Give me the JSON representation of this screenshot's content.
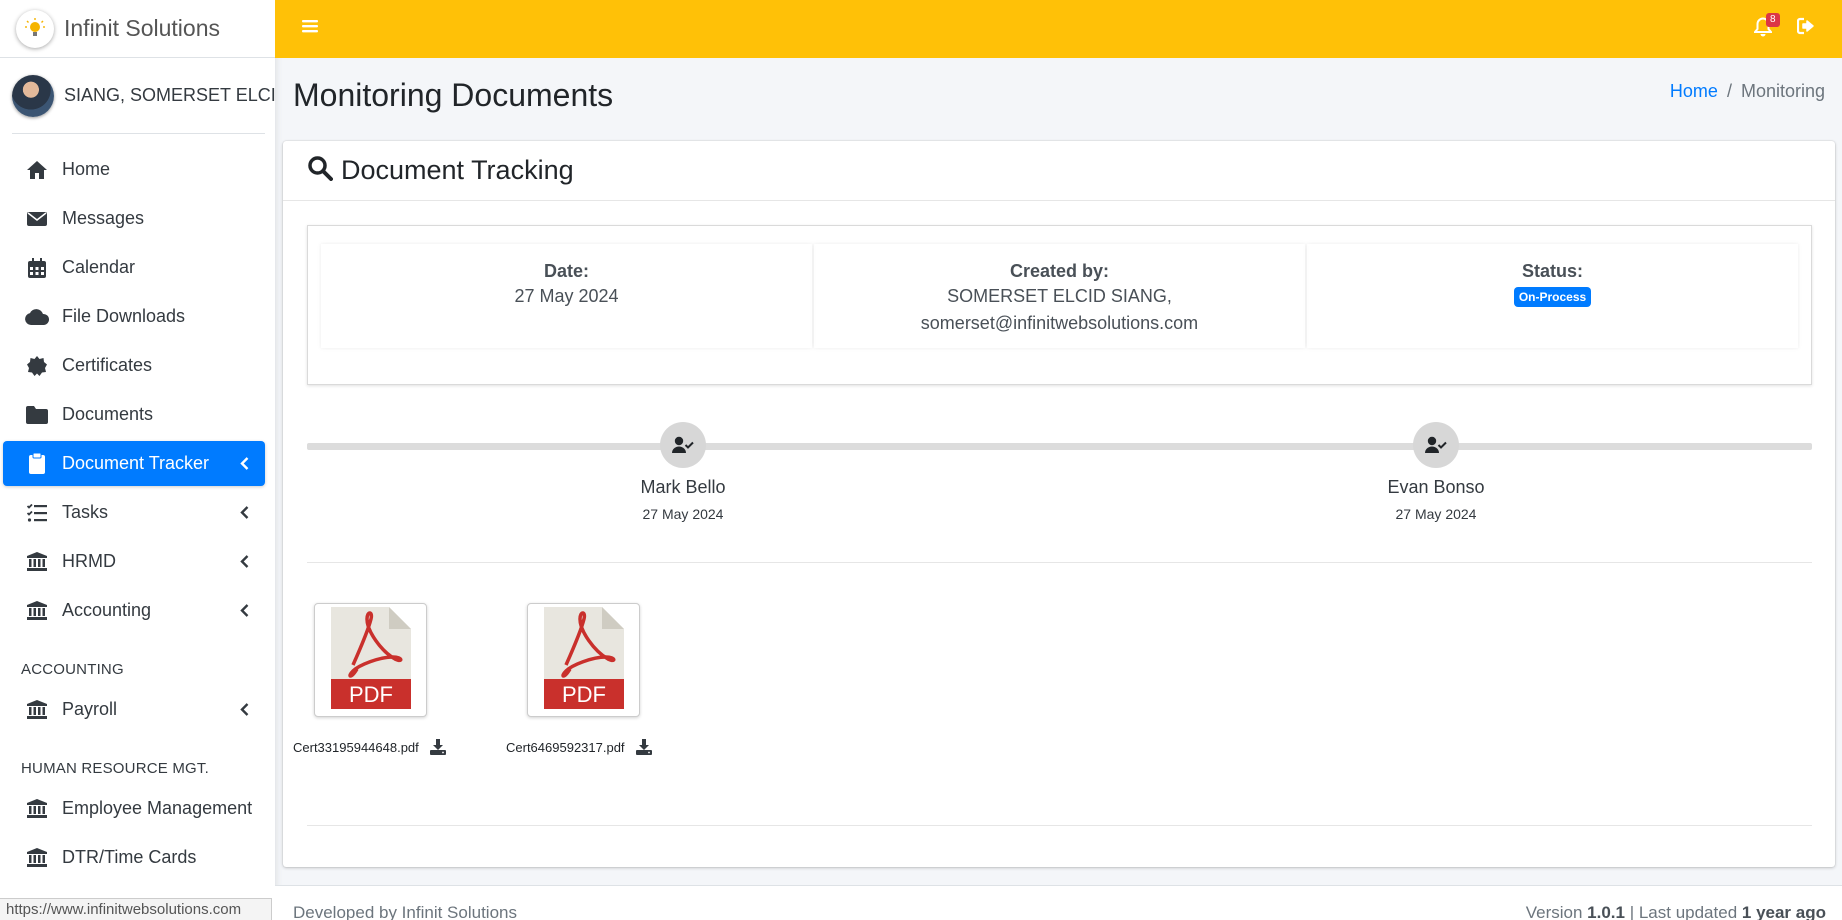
{
  "brand": {
    "name": "Infinit Solutions"
  },
  "user": {
    "name": "SIANG, SOMERSET ELCID"
  },
  "sidebar": {
    "items": [
      {
        "label": "Home",
        "icon": "home-icon"
      },
      {
        "label": "Messages",
        "icon": "envelope-icon"
      },
      {
        "label": "Calendar",
        "icon": "calendar-icon"
      },
      {
        "label": "File Downloads",
        "icon": "cloud-icon"
      },
      {
        "label": "Certificates",
        "icon": "certificate-icon"
      },
      {
        "label": "Documents",
        "icon": "folder-icon"
      },
      {
        "label": "Document Tracker",
        "icon": "clipboard-icon",
        "active": true
      },
      {
        "label": "Tasks",
        "icon": "tasks-icon"
      },
      {
        "label": "HRMD",
        "icon": "bank-icon"
      },
      {
        "label": "Accounting",
        "icon": "bank-icon"
      }
    ],
    "section_accounting": "ACCOUNTING",
    "payroll": {
      "label": "Payroll",
      "icon": "bank-icon"
    },
    "section_hr": "HUMAN RESOURCE MGT.",
    "employee_management": {
      "label": "Employee Management",
      "icon": "bank-icon"
    },
    "dtr": {
      "label": "DTR/Time Cards",
      "icon": "bank-icon"
    }
  },
  "topbar": {
    "notification_count": "8",
    "accent_color": "#ffc107"
  },
  "page": {
    "title": "Monitoring Documents",
    "breadcrumb": {
      "home": "Home",
      "separator": "/",
      "current": "Monitoring"
    }
  },
  "card": {
    "title": "Document Tracking",
    "info": {
      "date_label": "Date:",
      "date_value": "27 May 2024",
      "created_label": "Created by:",
      "created_name": "SOMERSET ELCID SIANG,",
      "created_email": "somerset@infinitwebsolutions.com",
      "status_label": "Status:",
      "status_value": "On-Process"
    },
    "timeline": [
      {
        "name": "Mark Bello",
        "date": "27 May 2024"
      },
      {
        "name": "Evan Bonso",
        "date": "27 May 2024"
      }
    ],
    "files": [
      {
        "name": "Cert33195944648.pdf",
        "type_label": "PDF"
      },
      {
        "name": "Cert6469592317.pdf",
        "type_label": "PDF"
      }
    ]
  },
  "footer": {
    "developed_by": "Developed by Infinit Solutions",
    "version_label": "Version",
    "version": "1.0.1",
    "updated_label": "| Last updated",
    "updated": "1 year ago"
  },
  "status_bar_url": "https://www.infinitwebsolutions.com"
}
